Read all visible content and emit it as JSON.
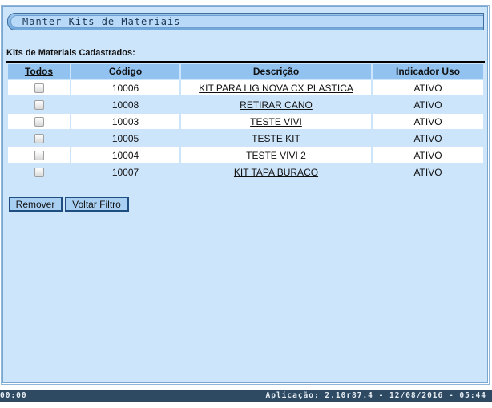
{
  "panel": {
    "title": "Manter Kits de Materiais",
    "section_label": "Kits de Materiais Cadastrados:"
  },
  "table": {
    "headers": {
      "select_all": "Todos",
      "codigo": "Código",
      "descricao": "Descrição",
      "indicador": "Indicador Uso"
    },
    "rows": [
      {
        "codigo": "10006",
        "descricao": "KIT PARA LIG NOVA CX PLASTICA",
        "indicador": "ATIVO",
        "checked": false
      },
      {
        "codigo": "10008",
        "descricao": "RETIRAR CANO",
        "indicador": "ATIVO",
        "checked": false
      },
      {
        "codigo": "10003",
        "descricao": "TESTE VIVI",
        "indicador": "ATIVO",
        "checked": false
      },
      {
        "codigo": "10005",
        "descricao": "TESTE KIT",
        "indicador": "ATIVO",
        "checked": false
      },
      {
        "codigo": "10004",
        "descricao": "TESTE VIVI 2",
        "indicador": "ATIVO",
        "checked": false
      },
      {
        "codigo": "10007",
        "descricao": "KIT TAPA BURACO",
        "indicador": "ATIVO",
        "checked": false
      }
    ]
  },
  "buttons": {
    "remover": "Remover",
    "voltar": "Voltar Filtro"
  },
  "status_bar": {
    "left_text": "00:00",
    "right_text": "Aplicação: 2.10r87.4 - 12/08/2016 - 05:44"
  },
  "colors": {
    "panel_bg": "#cde5fb",
    "header_bg": "#92c2ef",
    "status_bg": "#2e4a63"
  }
}
